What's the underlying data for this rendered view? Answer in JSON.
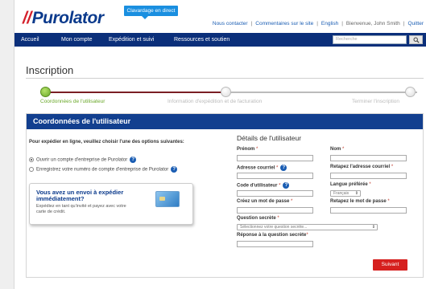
{
  "header": {
    "logo": "Purolator",
    "chat_label": "Clavardage en direct",
    "links": [
      "Nous contacter",
      "Commentaires sur le site",
      "English"
    ],
    "user_greeting": "Bienvenue, John Smith",
    "logout": "Quitter"
  },
  "nav": {
    "items": [
      "Accueil",
      "Mon compte",
      "Expédition et suivi",
      "Ressources et soutien"
    ],
    "search_placeholder": "Recherche"
  },
  "page": {
    "title": "Inscription"
  },
  "steps": [
    {
      "label": "Coordonnées de l'utilisateur",
      "active": true
    },
    {
      "label": "Information d'expédition et de facturation",
      "active": false
    },
    {
      "label": "Terminer l'inscription",
      "active": false
    }
  ],
  "panel": {
    "title": "Coordonnées de l'utilisateur",
    "intro": "Pour expédier en ligne, veuillez choisir l'une des options suivantes:",
    "options": [
      {
        "label": "Ouvrir un compte d'entreprise de Purolator",
        "selected": true
      },
      {
        "label": "Enregistrez votre numéro de compte d'entreprise de Purolator",
        "selected": false
      }
    ],
    "promo": {
      "title": "Vous avez un envoi à expédier immédiatement?",
      "text": "Expédiez en tant qu'invité et payez avec votre carte de crédit."
    }
  },
  "form": {
    "title": "Détails de l'utilisateur",
    "required_mark": "*",
    "first_name_label": "Prénom",
    "last_name_label": "Nom",
    "email_label": "Adresse courriel",
    "email_confirm_label": "Retapez l'adresse courriel",
    "user_code_label": "Code d'utilisateur",
    "language_label": "Langue préférée",
    "language_value": "Français",
    "password_label": "Créez un mot de passe",
    "password_confirm_label": "Retapez le mot de passe",
    "secret_question_label": "Question secrète",
    "secret_question_value": "Sélectionnez votre question secrète...",
    "secret_answer_label": "Réponse à la question secrète",
    "submit_label": "Suivant"
  },
  "icons": {
    "help": "?",
    "select_arrow": "⇕"
  },
  "colors": {
    "brand_blue": "#0b2f7a",
    "brand_red": "#d4202b",
    "step_active": "#6aa82a",
    "submit": "#d6201f"
  }
}
